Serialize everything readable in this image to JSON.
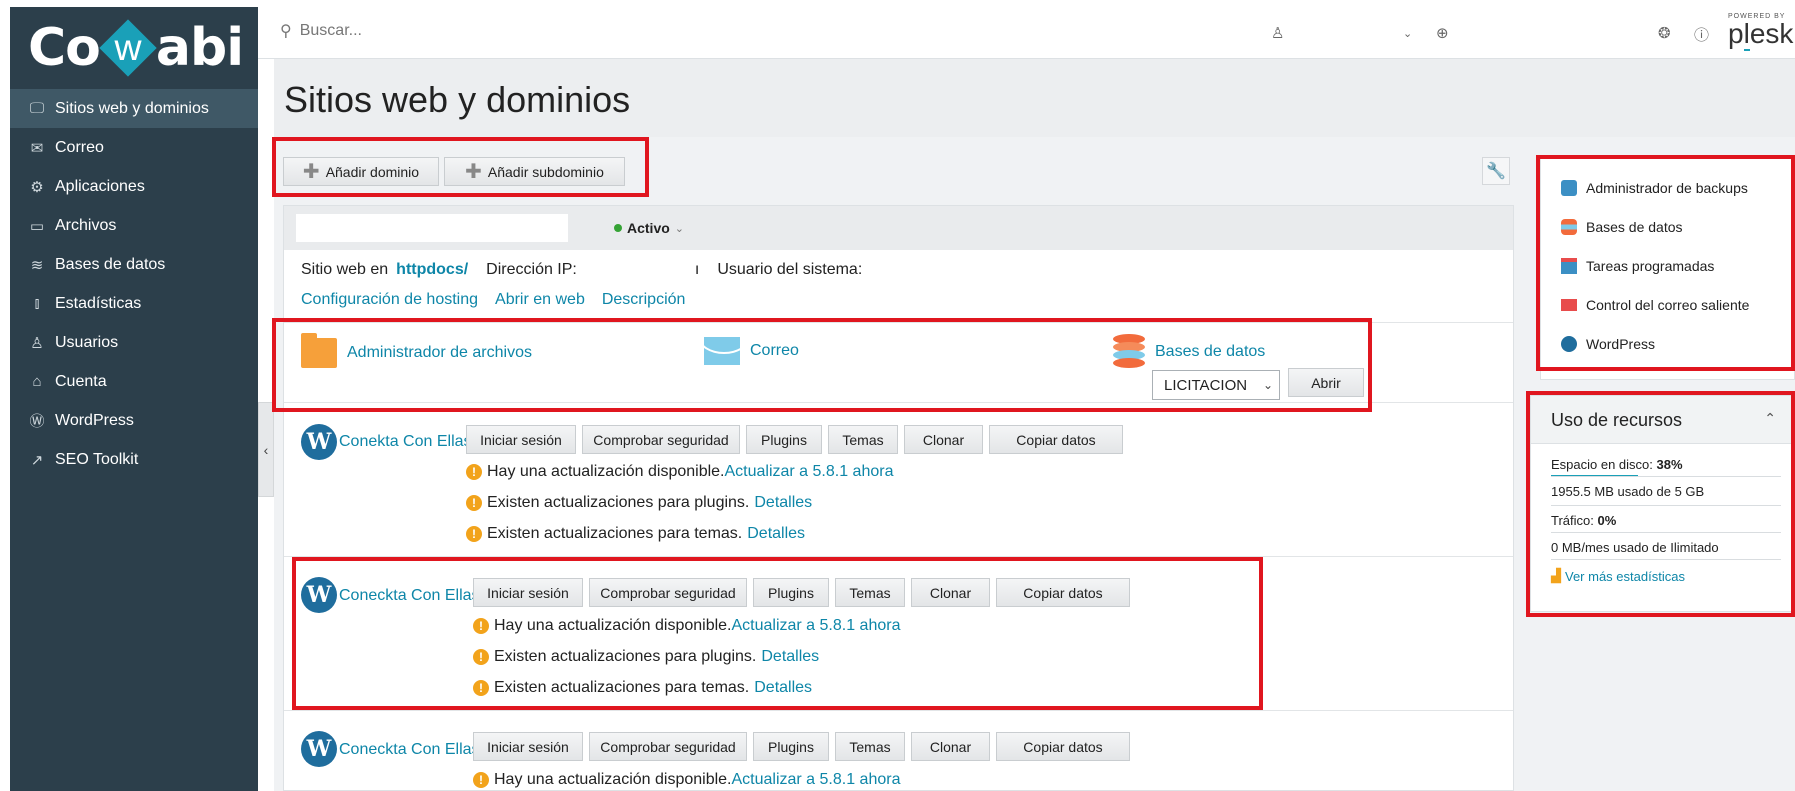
{
  "app": {
    "brand": "Cowabi"
  },
  "colors": {
    "sidebar_bg": "#2c3f4b",
    "accent": "#0e86a8",
    "highlight": "#e0161f",
    "active_status": "#35a335"
  },
  "search": {
    "placeholder": "Buscar..."
  },
  "plesk": {
    "powered": "POWERED BY",
    "word_pre": "p",
    "word_u": "l",
    "word_post": "esk"
  },
  "sidebar": {
    "items": [
      {
        "label": "Sitios web y dominios",
        "icon": "monitor-icon",
        "active": true
      },
      {
        "label": "Correo",
        "icon": "mail-icon"
      },
      {
        "label": "Aplicaciones",
        "icon": "gear-icon"
      },
      {
        "label": "Archivos",
        "icon": "folder-icon"
      },
      {
        "label": "Bases de datos",
        "icon": "database-icon"
      },
      {
        "label": "Estadísticas",
        "icon": "bar-chart-icon"
      },
      {
        "label": "Usuarios",
        "icon": "user-icon"
      },
      {
        "label": "Cuenta",
        "icon": "account-icon"
      },
      {
        "label": "WordPress",
        "icon": "wordpress-icon"
      },
      {
        "label": "SEO Toolkit",
        "icon": "seo-icon"
      }
    ]
  },
  "page": {
    "title": "Sitios web y dominios"
  },
  "toolbar": {
    "add_domain": "Añadir dominio",
    "add_subdomain": "Añadir subdominio"
  },
  "domain": {
    "status": "Activo",
    "site_prefix": "Sitio web en",
    "docroot": "httpdocs/",
    "ip_label": "Dirección IP:",
    "ip_value": "ı",
    "sysuser_label": "Usuario del sistema:",
    "links": [
      "Configuración de hosting",
      "Abrir en web",
      "Descripción"
    ],
    "tools": {
      "files": "Administrador de archivos",
      "mail": "Correo",
      "databases": "Bases de datos"
    },
    "db_select": "LICITACION",
    "open_button": "Abrir"
  },
  "sites": [
    {
      "name": "Conekta Con Ellas",
      "update_text": "Hay una actualización disponible.",
      "update_link": "Actualizar a 5.8.1 ahora",
      "plugins_text": "Existen actualizaciones para plugins.",
      "themes_text": "Existen actualizaciones para temas.",
      "details": "Detalles"
    },
    {
      "name": "Coneckta Con Ellas",
      "update_text": "Hay una actualización disponible.",
      "update_link": "Actualizar a 5.8.1 ahora",
      "plugins_text": "Existen actualizaciones para plugins.",
      "themes_text": "Existen actualizaciones para temas.",
      "details": "Detalles"
    },
    {
      "name": "Coneckta Con Ellas",
      "update_text": "Hay una actualización disponible.",
      "update_link": "Actualizar a 5.8.1 ahora"
    }
  ],
  "site_buttons": {
    "login": "Iniciar sesión",
    "security": "Comprobar seguridad",
    "plugins": "Plugins",
    "themes": "Temas",
    "clone": "Clonar",
    "copy": "Copiar datos"
  },
  "right_panel": {
    "items": [
      "Administrador de backups",
      "Bases de datos",
      "Tareas programadas",
      "Control del correo saliente",
      "WordPress"
    ]
  },
  "resources": {
    "title": "Uso de recursos",
    "disk_label": "Espacio en disco:",
    "disk_value": "38%",
    "disk_percent": 38,
    "disk_usage": "1955.5 MB usado de 5 GB",
    "traffic_label": "Tráfico:",
    "traffic_value": "0%",
    "traffic_usage": "0 MB/mes usado de Ilimitado",
    "more_stats": "Ver más estadísticas"
  }
}
